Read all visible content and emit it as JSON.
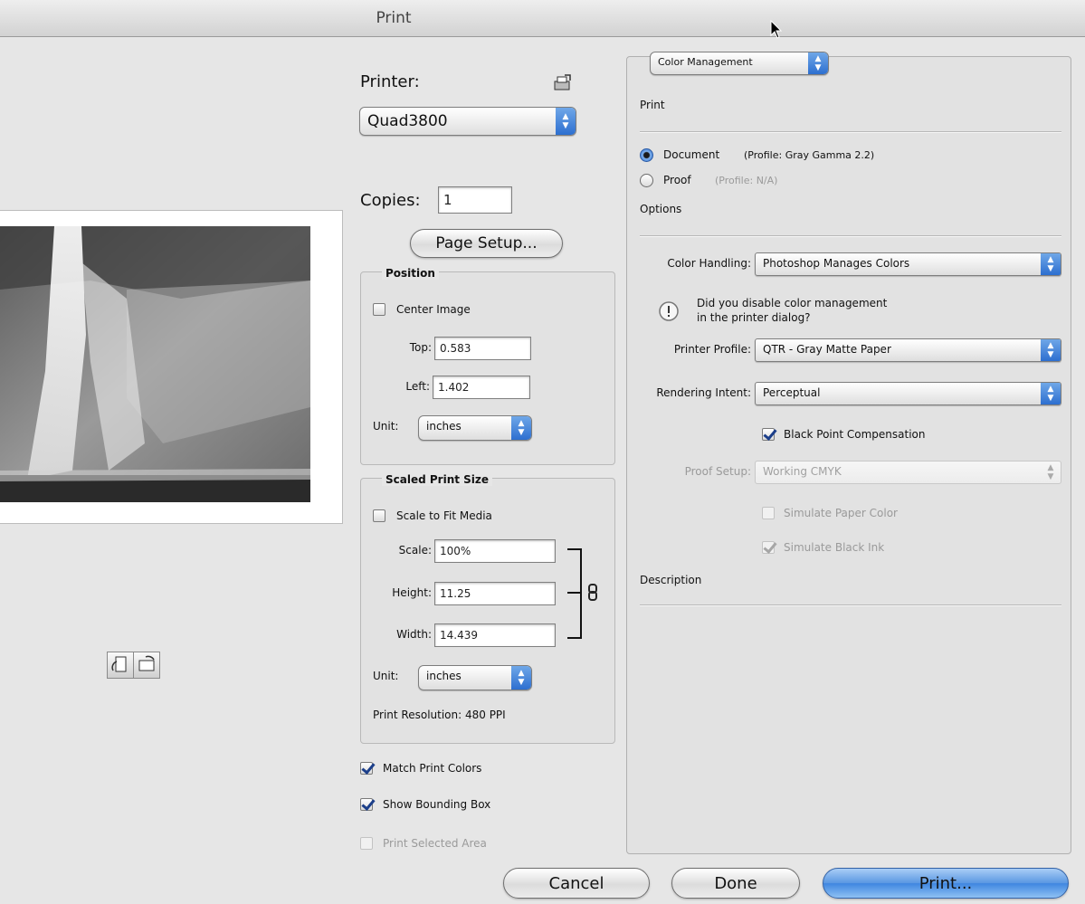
{
  "window": {
    "title": "Print"
  },
  "icons": {
    "cursor": "arrow-cursor-icon",
    "printer_utility": "printer-utility-icon",
    "portrait": "portrait-orientation-icon",
    "landscape": "landscape-orientation-icon",
    "link": "chain-link-icon",
    "warning": "info-exclamation-icon"
  },
  "printer": {
    "label": "Printer:",
    "value": "Quad3800"
  },
  "copies": {
    "label": "Copies:",
    "value": "1"
  },
  "page_setup": {
    "label": "Page Setup..."
  },
  "position": {
    "title": "Position",
    "center_image": {
      "label": "Center Image",
      "checked": false
    },
    "top": {
      "label": "Top:",
      "value": "0.583"
    },
    "left": {
      "label": "Left:",
      "value": "1.402"
    },
    "unit": {
      "label": "Unit:",
      "value": "inches"
    }
  },
  "scaled": {
    "title": "Scaled Print Size",
    "scale_to_fit": {
      "label": "Scale to Fit Media",
      "checked": false
    },
    "scale": {
      "label": "Scale:",
      "value": "100%"
    },
    "height": {
      "label": "Height:",
      "value": "11.25"
    },
    "width": {
      "label": "Width:",
      "value": "14.439"
    },
    "unit": {
      "label": "Unit:",
      "value": "inches"
    },
    "resolution": "Print Resolution: 480 PPI"
  },
  "options": {
    "match_print_colors": {
      "label": "Match Print Colors",
      "checked": true
    },
    "show_bounding_box": {
      "label": "Show Bounding Box",
      "checked": true
    },
    "print_selected_area": {
      "label": "Print Selected Area",
      "checked": false,
      "enabled": false
    }
  },
  "right": {
    "section_popup": "Color Management",
    "print_header": "Print",
    "document": {
      "label": "Document",
      "profile": "(Profile: Gray Gamma 2.2)",
      "selected": true
    },
    "proof": {
      "label": "Proof",
      "profile": "(Profile: N/A)",
      "selected": false
    },
    "options_header": "Options",
    "color_handling": {
      "label": "Color Handling:",
      "value": "Photoshop Manages Colors"
    },
    "warning": {
      "line1": "Did you disable color management",
      "line2": "in the printer dialog?"
    },
    "printer_profile": {
      "label": "Printer Profile:",
      "value": "QTR - Gray Matte Paper"
    },
    "rendering_intent": {
      "label": "Rendering Intent:",
      "value": "Perceptual"
    },
    "black_point": {
      "label": "Black Point Compensation",
      "checked": true
    },
    "proof_setup": {
      "label": "Proof Setup:",
      "value": "Working CMYK",
      "enabled": false
    },
    "simulate_paper": {
      "label": "Simulate Paper Color",
      "checked": false,
      "enabled": false
    },
    "simulate_ink": {
      "label": "Simulate Black Ink",
      "checked": true,
      "enabled": false
    },
    "description_header": "Description"
  },
  "buttons": {
    "cancel": "Cancel",
    "done": "Done",
    "print": "Print..."
  },
  "colors": {
    "accent": "#3f86e0",
    "background": "#e6e6e6"
  }
}
